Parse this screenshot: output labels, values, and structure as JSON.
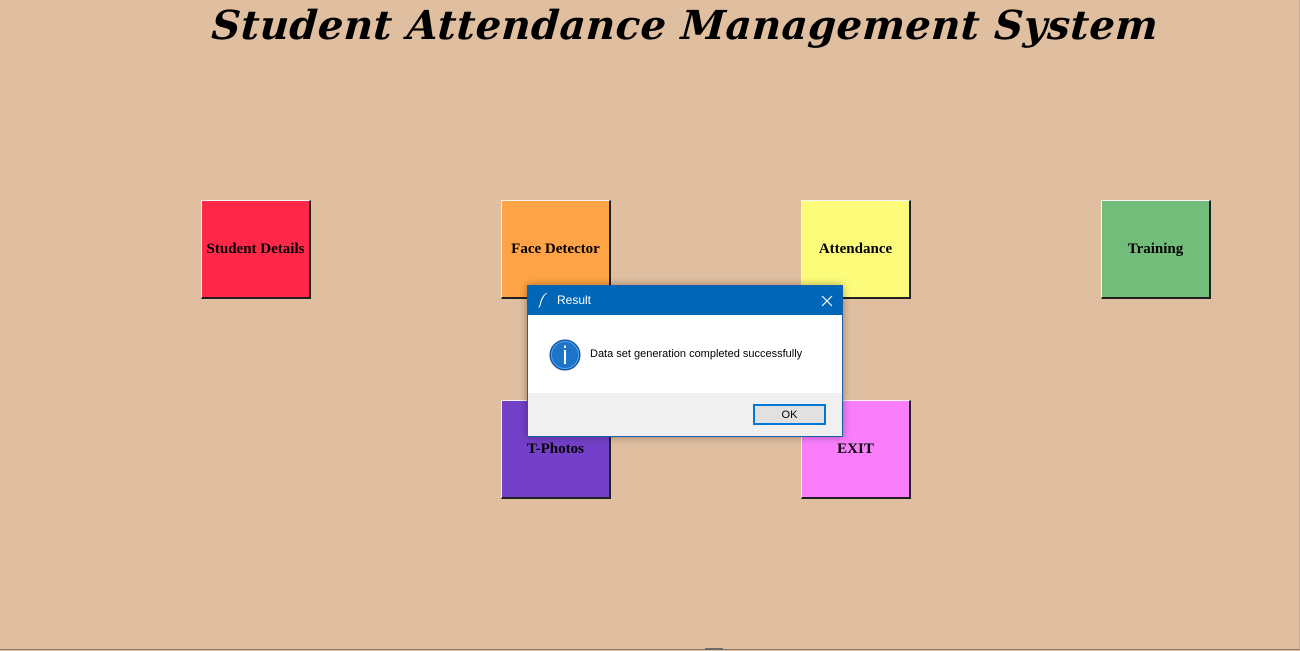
{
  "app": {
    "title": "Student Attendance Management System",
    "background": "#e0bfa0"
  },
  "tiles": [
    {
      "label": "Student Details",
      "color": "#ff2849"
    },
    {
      "label": "Face Detector",
      "color": "#ffa446"
    },
    {
      "label": "Attendance",
      "color": "#fdfc7a"
    },
    {
      "label": "Training",
      "color": "#73bd7a"
    },
    {
      "label": "T-Photos",
      "color": "#7540c9"
    },
    {
      "label": "EXIT",
      "color": "#fa7efc"
    }
  ],
  "dialog": {
    "title": "Result",
    "message": "Data set generation completed successfully",
    "ok_label": "OK",
    "icon": "info-icon",
    "titlebar_color": "#0067b8"
  }
}
